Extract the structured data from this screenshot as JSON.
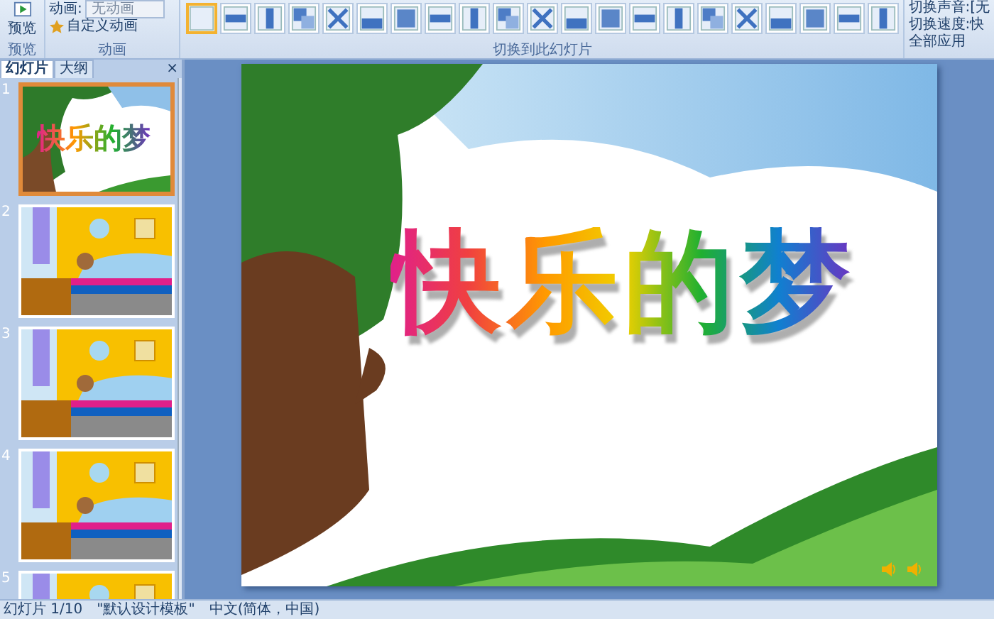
{
  "ribbon": {
    "preview_button": "预览",
    "animation_label": "动画:",
    "animation_value": "无动画",
    "custom_animation": "自定义动画",
    "groups": [
      "预览",
      "动画",
      "切换到此幻灯片"
    ],
    "transitions": [
      {
        "selected": true
      },
      {
        "selected": false
      },
      {
        "selected": false
      },
      {
        "selected": false
      },
      {
        "selected": false
      },
      {
        "selected": false
      },
      {
        "selected": false
      },
      {
        "selected": false
      },
      {
        "selected": false
      },
      {
        "selected": false
      },
      {
        "selected": false
      },
      {
        "selected": false
      },
      {
        "selected": false
      },
      {
        "selected": false
      },
      {
        "selected": false
      },
      {
        "selected": false
      },
      {
        "selected": false
      },
      {
        "selected": false
      },
      {
        "selected": false
      },
      {
        "selected": false
      },
      {
        "selected": false
      }
    ],
    "sound_label": "切换声音:",
    "sound_value": "[无",
    "speed_label": "切换速度:",
    "speed_value": "快",
    "apply_all": "全部应用"
  },
  "panel": {
    "tabs": [
      {
        "label": "幻灯片",
        "selected": true
      },
      {
        "label": "大纲",
        "selected": false
      }
    ],
    "close": "×",
    "slides": [
      {
        "number": "1",
        "selected": true,
        "kind": "title",
        "title": "快乐的梦"
      },
      {
        "number": "2",
        "selected": false,
        "kind": "bedroom"
      },
      {
        "number": "3",
        "selected": false,
        "kind": "bedroom"
      },
      {
        "number": "4",
        "selected": false,
        "kind": "bedroom"
      },
      {
        "number": "5",
        "selected": false,
        "kind": "bedroom"
      }
    ]
  },
  "slide": {
    "title": "快乐的梦"
  },
  "status_bar": [
    "幻灯片 1/10",
    "\"默认设计模板\"",
    "中文(简体，中国)"
  ]
}
